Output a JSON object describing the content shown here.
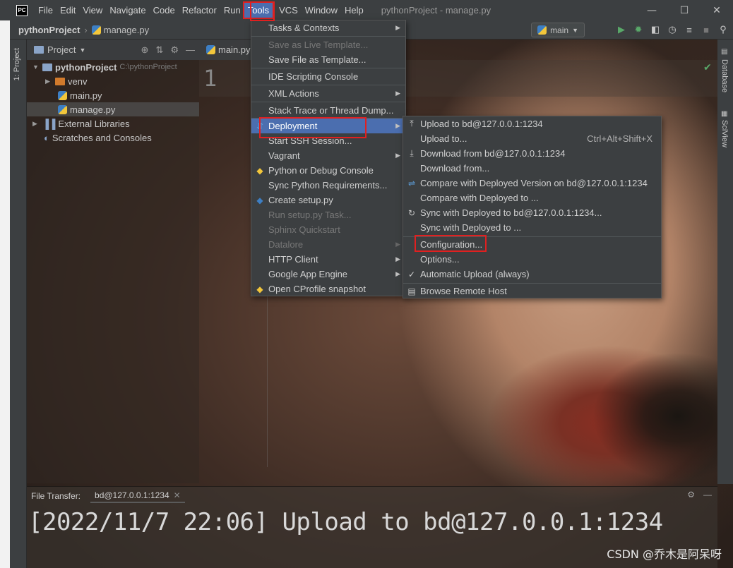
{
  "menubar": {
    "items": [
      "File",
      "Edit",
      "View",
      "Navigate",
      "Code",
      "Refactor",
      "Run",
      "Tools",
      "VCS",
      "Window",
      "Help"
    ],
    "window_title": "pythonProject - manage.py"
  },
  "navbar": {
    "project": "pythonProject",
    "file": "manage.py",
    "run_config": "main"
  },
  "left_strip": {
    "tab": "1: Project"
  },
  "project_panel": {
    "title": "Project",
    "root": "pythonProject",
    "root_path": "C:\\pythonProject",
    "items": [
      "venv",
      "main.py",
      "manage.py",
      "External Libraries",
      "Scratches and Consoles"
    ]
  },
  "editor": {
    "tab": "main.py",
    "line_number": "1"
  },
  "right_strip": {
    "tab1": "Database",
    "tab2": "SciView"
  },
  "tools_menu": {
    "items": [
      {
        "label": "Tasks & Contexts",
        "submenu": true,
        "disabled": false
      },
      {
        "label": "Save as Live Template...",
        "disabled": true
      },
      {
        "label": "Save File as Template...",
        "disabled": false
      },
      {
        "label": "IDE Scripting Console",
        "disabled": false
      },
      {
        "label": "XML Actions",
        "submenu": true,
        "disabled": false
      },
      {
        "label": "Stack Trace or Thread Dump...",
        "disabled": false
      },
      {
        "label": "Deployment",
        "submenu": true,
        "highlight": true,
        "icon": "deployment-icon"
      },
      {
        "label": "Start SSH Session...",
        "disabled": false
      },
      {
        "label": "Vagrant",
        "submenu": true,
        "disabled": false
      },
      {
        "label": "Python or Debug Console",
        "icon": "python-icon"
      },
      {
        "label": "Sync Python Requirements...",
        "disabled": false
      },
      {
        "label": "Create setup.py",
        "icon": "setup-icon"
      },
      {
        "label": "Run setup.py Task...",
        "disabled": true
      },
      {
        "label": "Sphinx Quickstart",
        "disabled": true
      },
      {
        "label": "Datalore",
        "submenu": true,
        "disabled": true
      },
      {
        "label": "HTTP Client",
        "submenu": true,
        "disabled": false
      },
      {
        "label": "Google App Engine",
        "submenu": true,
        "disabled": false
      },
      {
        "label": "Open CProfile snapshot",
        "icon": "cprofile-icon"
      }
    ]
  },
  "deployment_menu": {
    "items": [
      {
        "label": "Upload to bd@127.0.0.1:1234",
        "icon": "upload-icon"
      },
      {
        "label": "Upload to...",
        "shortcut": "Ctrl+Alt+Shift+X"
      },
      {
        "label": "Download from bd@127.0.0.1:1234",
        "icon": "download-icon"
      },
      {
        "label": "Download from..."
      },
      {
        "label": "Compare with Deployed Version on bd@127.0.0.1:1234",
        "icon": "compare-icon"
      },
      {
        "label": "Compare with Deployed to ..."
      },
      {
        "label": "Sync with Deployed to bd@127.0.0.1:1234...",
        "icon": "sync-icon"
      },
      {
        "label": "Sync with Deployed to ..."
      },
      {
        "label": "Configuration..."
      },
      {
        "label": "Options..."
      },
      {
        "label": "Automatic Upload (always)",
        "icon": "check-icon"
      },
      {
        "label": "Browse Remote Host",
        "icon": "browse-icon"
      }
    ]
  },
  "bottom_panel": {
    "label": "File Transfer:",
    "tab": "bd@127.0.0.1:1234"
  },
  "log_text": "[2022/11/7 22:06] Upload to bd@127.0.0.1:1234",
  "watermark": "CSDN @乔木是阿呆呀",
  "colors": {
    "highlight": "#4b6eaf",
    "annotation": "#e02020",
    "menu_bg": "#3c3f41"
  }
}
